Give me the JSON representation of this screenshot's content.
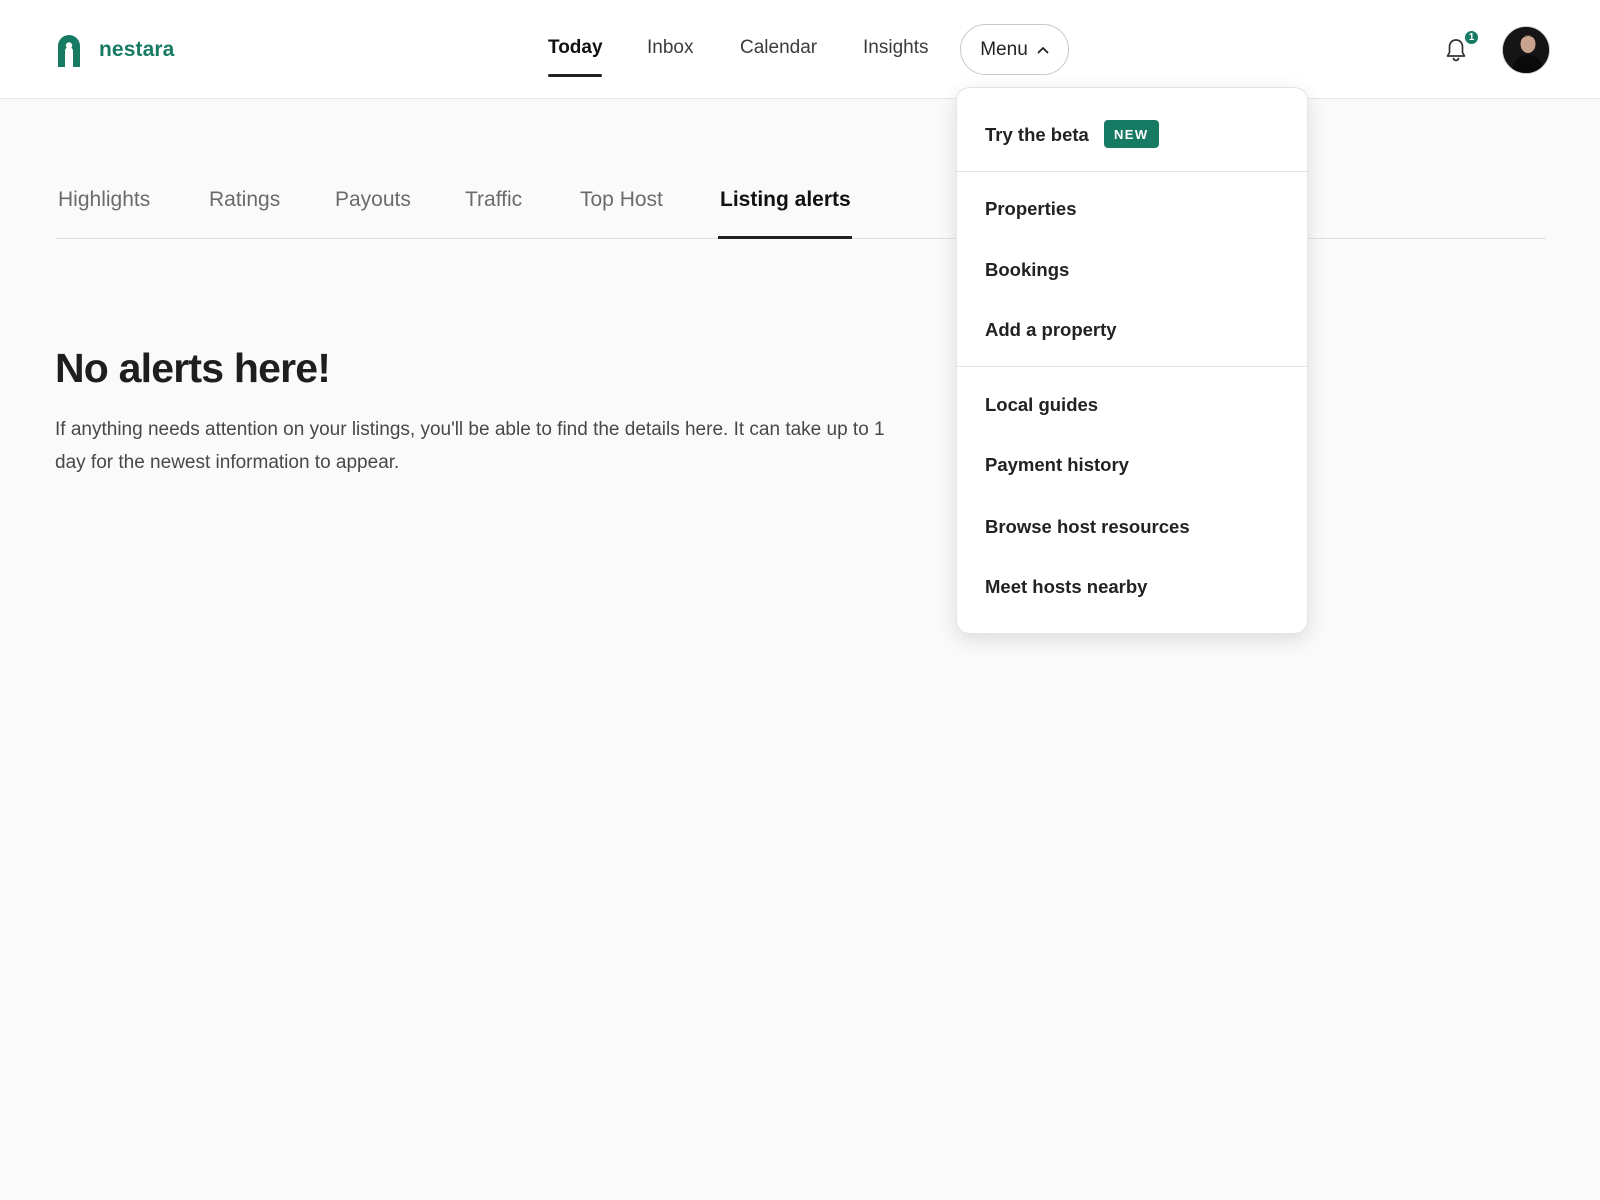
{
  "brand": {
    "name": "nestara",
    "color": "#177a63"
  },
  "nav": {
    "items": [
      {
        "label": "Today",
        "active": true
      },
      {
        "label": "Inbox",
        "active": false
      },
      {
        "label": "Calendar",
        "active": false
      },
      {
        "label": "Insights",
        "active": false
      }
    ],
    "menu_label": "Menu",
    "menu_icon": "chevron-up-icon"
  },
  "notifications": {
    "icon": "bell-icon",
    "count": "1"
  },
  "profile": {
    "icon": "avatar"
  },
  "tabs": [
    {
      "label": "Highlights",
      "active": false
    },
    {
      "label": "Ratings",
      "active": false
    },
    {
      "label": "Payouts",
      "active": false
    },
    {
      "label": "Traffic",
      "active": false
    },
    {
      "label": "Top Host",
      "active": false
    },
    {
      "label": "Listing alerts",
      "active": true
    }
  ],
  "empty_state": {
    "title": "No alerts here!",
    "description": "If anything needs attention on your listings, you'll be able to find the details here. It can take up to 1 day for the newest information to appear."
  },
  "dropdown": {
    "beta": {
      "label": "Try the beta",
      "badge": "NEW"
    },
    "group1": [
      "Properties",
      "Bookings",
      "Add a property"
    ],
    "group2": [
      "Local guides",
      "Payment history",
      "Browse host resources",
      "Meet hosts nearby"
    ]
  }
}
